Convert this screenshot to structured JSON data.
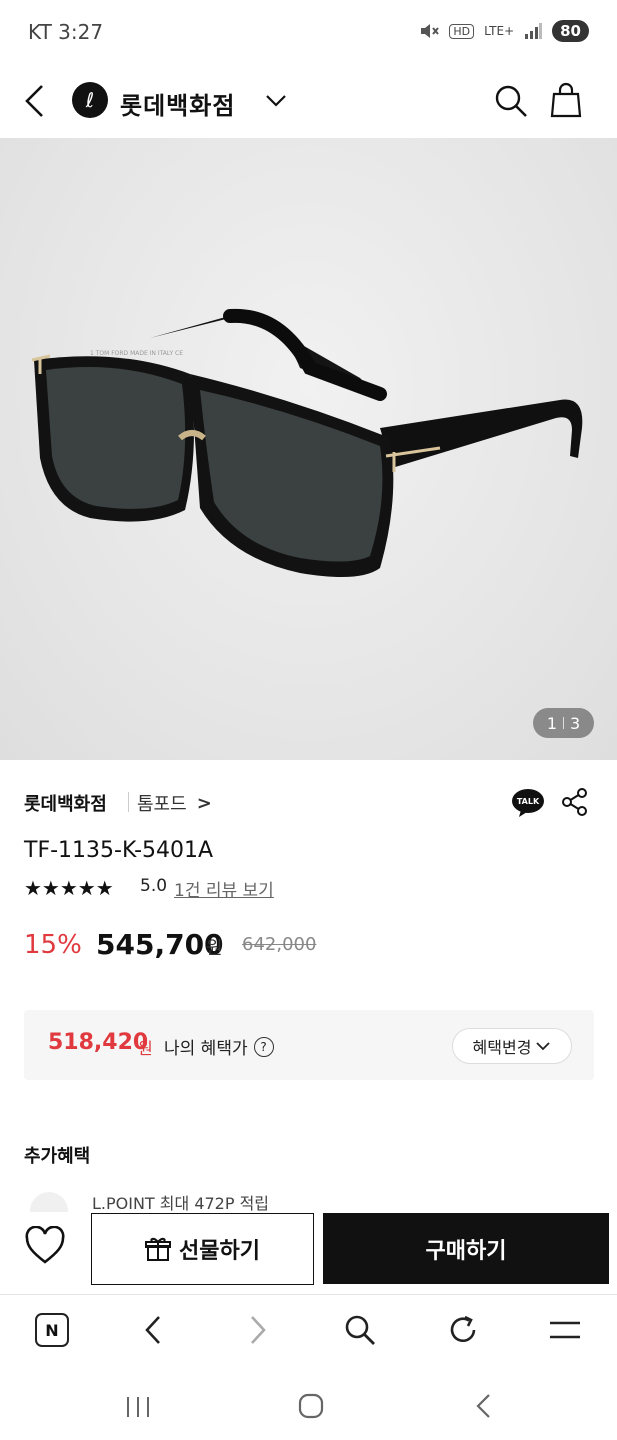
{
  "status_bar": {
    "time": "KT 3:27",
    "network": "LTE+",
    "hd": "HD",
    "battery": "80"
  },
  "header": {
    "back_icon": "chevron-left-icon",
    "store_logo_letter": "ℓ",
    "store_name": "롯데백화점",
    "dropdown_icon": "chevron-down-icon",
    "search_icon": "search-icon",
    "cart_icon": "shopping-bag-icon"
  },
  "gallery": {
    "current": "1",
    "total": "3"
  },
  "product": {
    "store": "롯데백화점",
    "brand": "톰포드",
    "brand_arrow": ">",
    "model": "TF-1135-K-5401A",
    "stars": "★★★★★",
    "rating": "5.0",
    "review_link": "1건 리뷰 보기",
    "talk_label": "TALK",
    "discount": "15%",
    "price": "545,700",
    "currency": "원",
    "original_price": "642,000"
  },
  "benefit": {
    "price": "518,420",
    "currency": "원",
    "label": "나의 혜택가",
    "help": "?",
    "change_button": "혜택변경"
  },
  "extra": {
    "title": "추가혜택",
    "lpoint": "L.POINT 최대 472P 적립"
  },
  "actions": {
    "gift_button": "선물하기",
    "buy_button": "구매하기"
  },
  "browser_nav": {
    "home_label": "N"
  },
  "colors": {
    "accent_red": "#e0393e",
    "dark": "#111111"
  }
}
